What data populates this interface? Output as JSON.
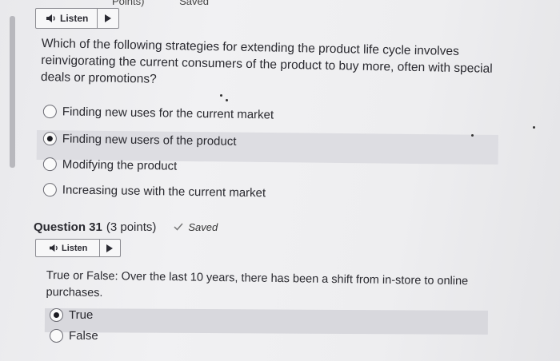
{
  "prev_fragment": {
    "left": "Points)",
    "right": "Saved"
  },
  "q30": {
    "listen_label": "Listen",
    "text": "Which of the following strategies for extending the product life cycle involves reinvigorating the current consumers of the product to buy more, often with special deals or promotions?",
    "options": [
      {
        "label": "Finding new uses for the current market",
        "checked": false
      },
      {
        "label": "Finding new users of the product",
        "checked": true
      },
      {
        "label": "Modifying the product",
        "checked": false
      },
      {
        "label": "Increasing use with the current market",
        "checked": false
      }
    ]
  },
  "q31": {
    "title": "Question 31",
    "points": "(3 points)",
    "saved_label": "Saved",
    "listen_label": "Listen",
    "text": "True or False: Over the last 10 years, there has been a shift from in-store to online purchases.",
    "options": [
      {
        "label": "True",
        "checked": true
      },
      {
        "label": "False",
        "checked": false
      }
    ]
  },
  "icons": {
    "speaker": "speaker-icon",
    "play": "play-icon",
    "check": "check-icon",
    "radio": "radio-button"
  },
  "colors": {
    "selected_row": "#dddde2",
    "border": "#8c8c92",
    "text": "#2a2a30"
  }
}
